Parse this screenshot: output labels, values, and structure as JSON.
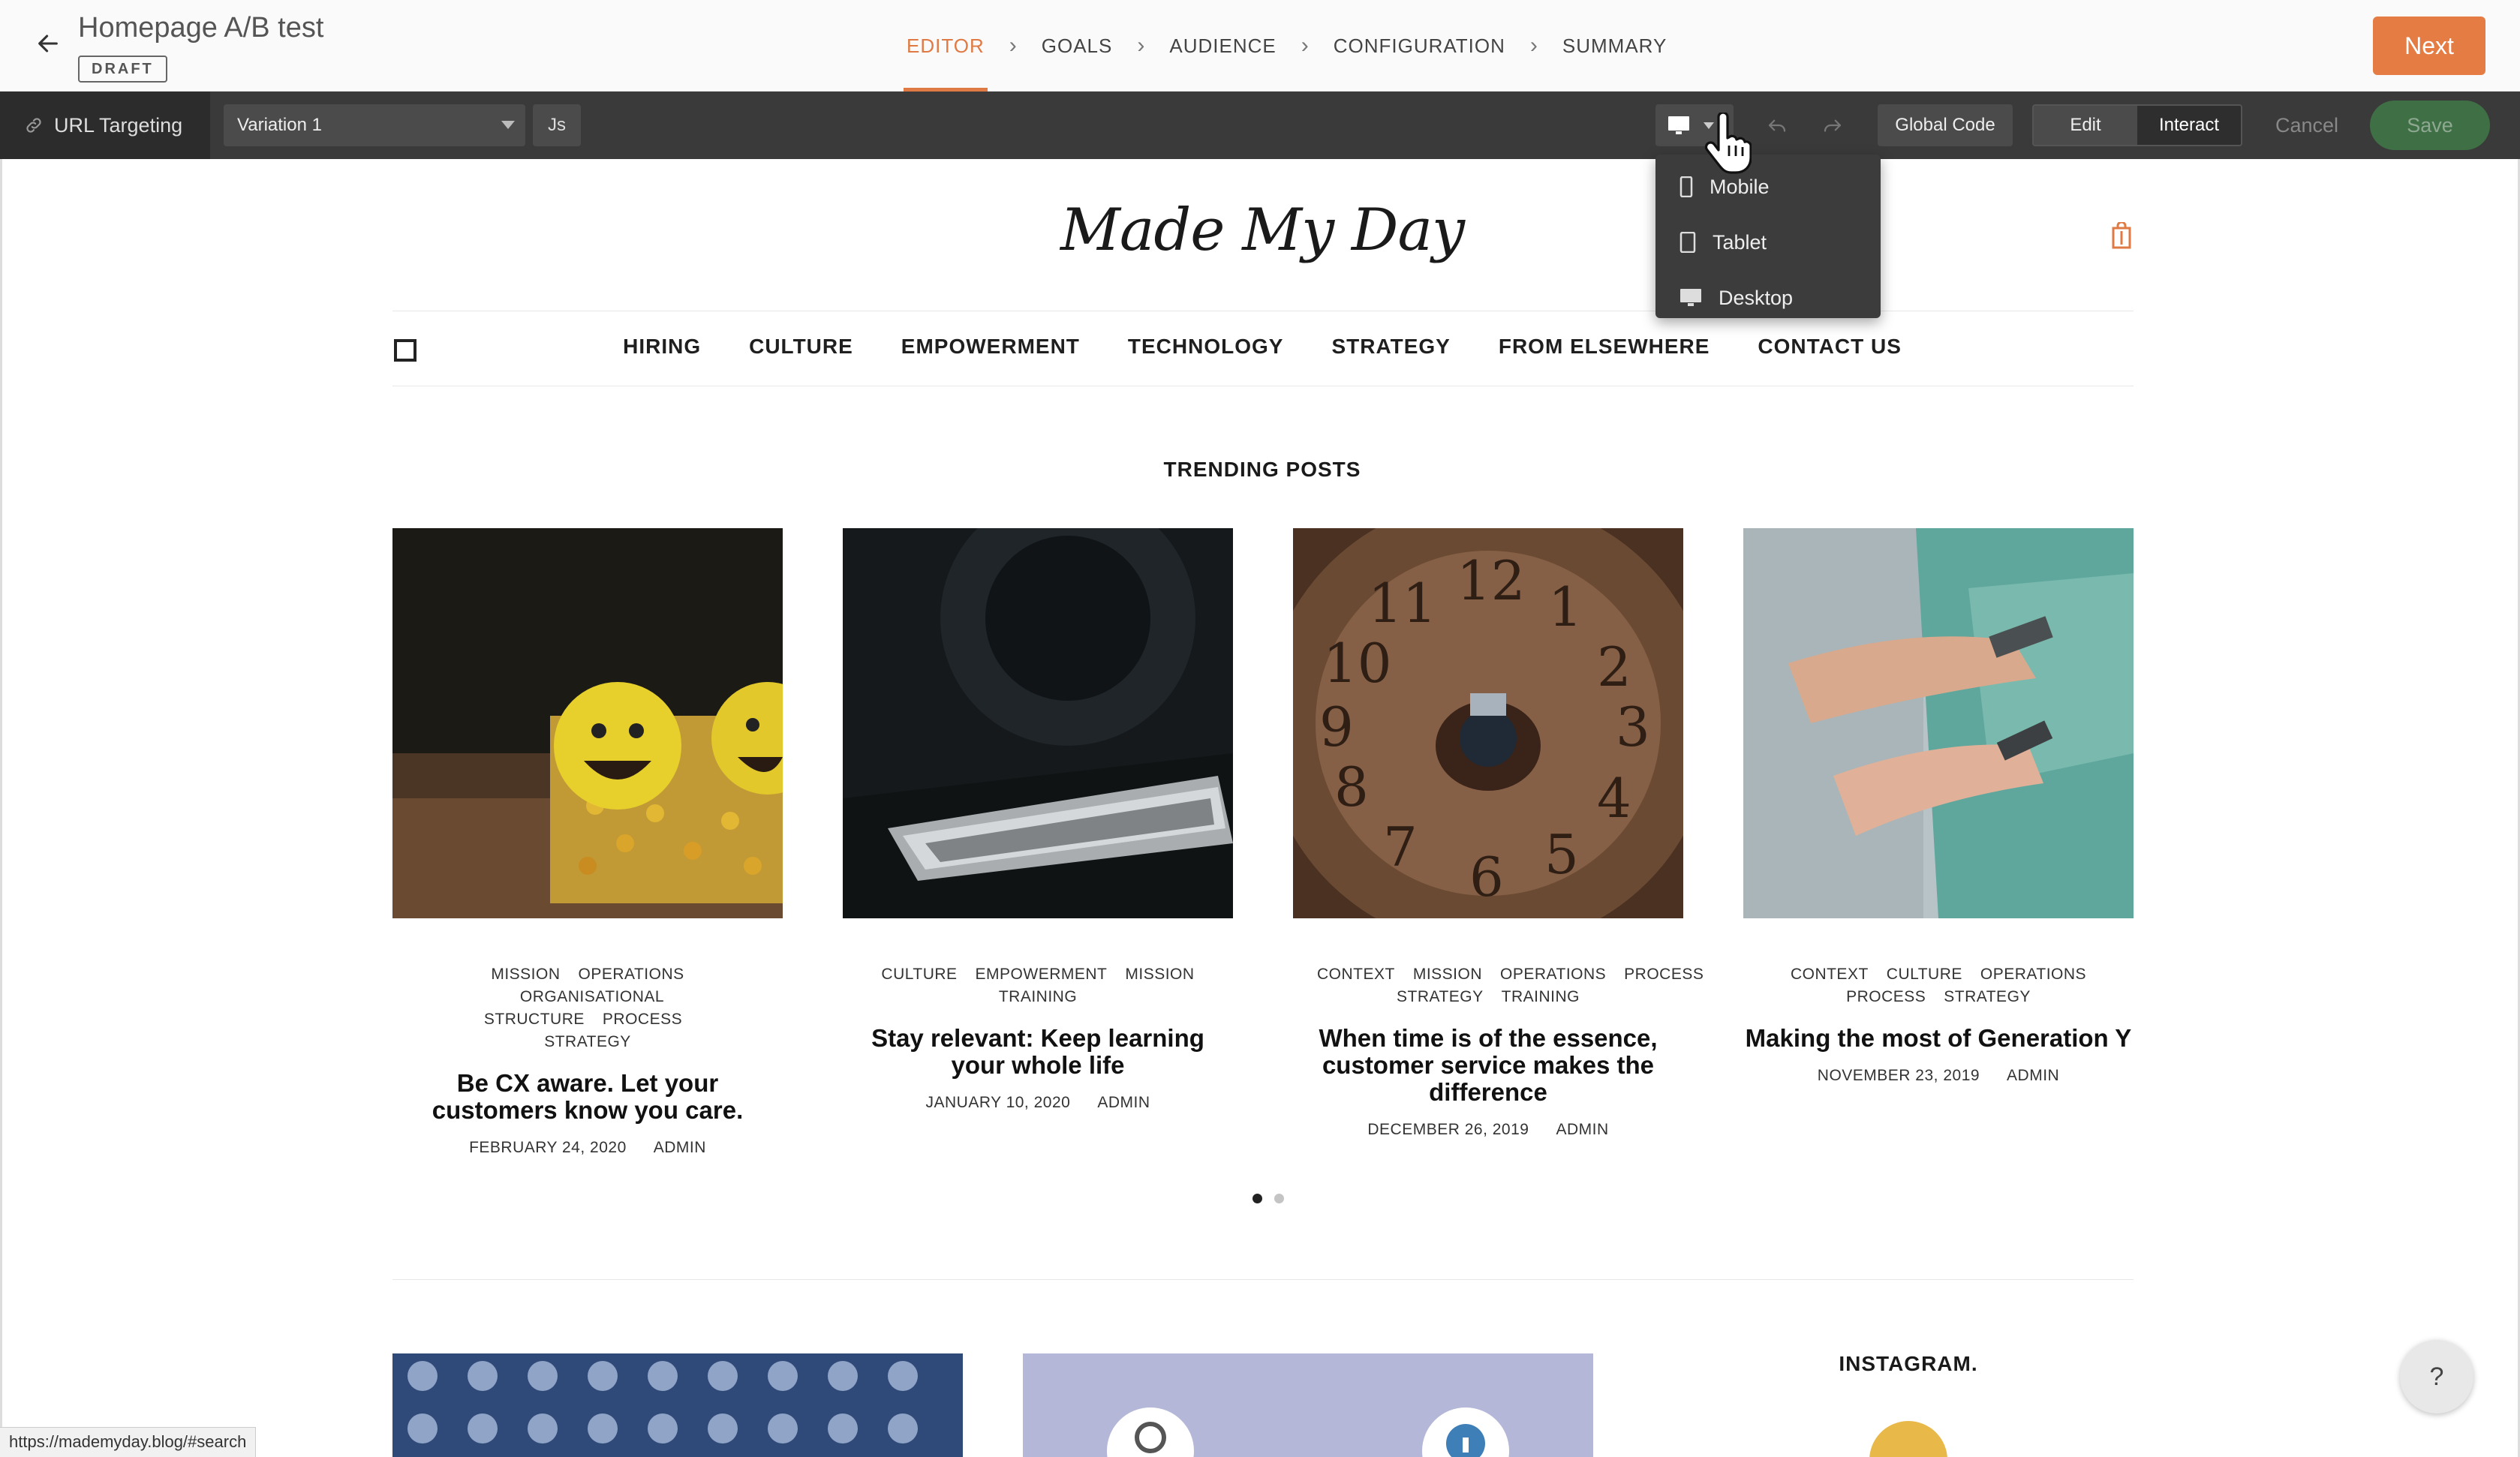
{
  "header": {
    "title": "Homepage A/B test",
    "status_badge": "DRAFT",
    "steps": [
      {
        "label": "EDITOR",
        "active": true
      },
      {
        "label": "GOALS",
        "active": false
      },
      {
        "label": "AUDIENCE",
        "active": false
      },
      {
        "label": "CONFIGURATION",
        "active": false
      },
      {
        "label": "SUMMARY",
        "active": false
      }
    ],
    "next_label": "Next",
    "accent_color": "#e57c43"
  },
  "toolbar": {
    "url_targeting_label": "URL Targeting",
    "variation_selected": "Variation 1",
    "js_label": "Js",
    "device_icon": "desktop-icon",
    "global_code_label": "Global Code",
    "edit_label": "Edit",
    "interact_label": "Interact",
    "cancel_label": "Cancel",
    "save_label": "Save",
    "save_color": "#3f6f44"
  },
  "device_menu": {
    "items": [
      {
        "label": "Mobile",
        "icon": "mobile-icon"
      },
      {
        "label": "Tablet",
        "icon": "tablet-icon"
      },
      {
        "label": "Desktop",
        "icon": "desktop-icon"
      }
    ]
  },
  "site": {
    "logo_text": "Made My Day",
    "nav": [
      "HIRING",
      "CULTURE",
      "EMPOWERMENT",
      "TECHNOLOGY",
      "STRATEGY",
      "FROM ELSEWHERE",
      "CONTACT US"
    ],
    "trending_heading": "TRENDING POSTS",
    "posts": [
      {
        "tags_line1": [
          "MISSION",
          "OPERATIONS"
        ],
        "tags_line2": [
          "ORGANISATIONAL STRUCTURE",
          "PROCESS"
        ],
        "tags_line3": [
          "STRATEGY"
        ],
        "title": "Be CX aware. Let your customers know you care.",
        "date": "FEBRUARY 24, 2020",
        "author": "ADMIN"
      },
      {
        "tags_line1": [
          "CULTURE",
          "EMPOWERMENT",
          "MISSION"
        ],
        "tags_line2": [
          "TRAINING"
        ],
        "tags_line3": [],
        "title": "Stay relevant: Keep learning your whole life",
        "date": "JANUARY 10, 2020",
        "author": "ADMIN"
      },
      {
        "tags_line1": [
          "CONTEXT",
          "MISSION",
          "OPERATIONS",
          "PROCESS"
        ],
        "tags_line2": [
          "STRATEGY",
          "TRAINING"
        ],
        "tags_line3": [],
        "title": "When time is of the essence, customer service makes the difference",
        "date": "DECEMBER 26, 2019",
        "author": "ADMIN"
      },
      {
        "tags_line1": [
          "CONTEXT",
          "CULTURE",
          "OPERATIONS"
        ],
        "tags_line2": [
          "PROCESS",
          "STRATEGY"
        ],
        "tags_line3": [],
        "title": "Making the most of Generation Y",
        "date": "NOVEMBER 23, 2019",
        "author": "ADMIN"
      }
    ],
    "carousel_pages": 2,
    "carousel_active": 1,
    "instagram_heading": "INSTAGRAM."
  },
  "help_label": "?",
  "status_bar_url": "https://mademyday.blog/#search"
}
